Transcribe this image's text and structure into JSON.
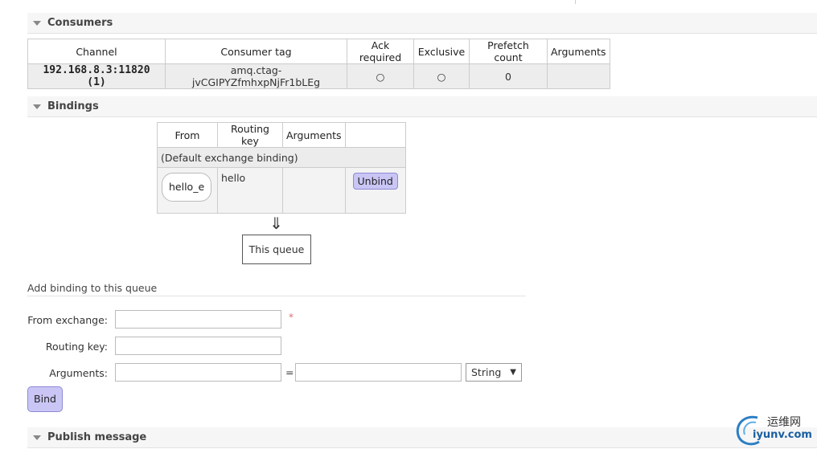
{
  "consumers": {
    "header": "Consumers",
    "columns": [
      "Channel",
      "Consumer tag",
      "Ack required",
      "Exclusive",
      "Prefetch count",
      "Arguments"
    ],
    "row": {
      "channel": "192.168.8.3:11820 (1)",
      "consumer_tag": "amq.ctag-jvCGIPYZfmhxpNjFr1bLEg",
      "ack_required": "○",
      "exclusive": "○",
      "prefetch_count": "0",
      "arguments": ""
    }
  },
  "bindings": {
    "header": "Bindings",
    "columns": [
      "From",
      "Routing key",
      "Arguments",
      ""
    ],
    "default_binding": "(Default exchange binding)",
    "row": {
      "from": "hello_e",
      "routing_key": "hello",
      "arguments": "",
      "unbind_label": "Unbind"
    },
    "arrow": "⇓",
    "this_queue": "This queue"
  },
  "add_binding": {
    "title": "Add binding to this queue",
    "from_exchange_label": "From exchange:",
    "from_exchange_value": "",
    "required_marker": "*",
    "routing_key_label": "Routing key:",
    "routing_key_value": "",
    "arguments_label": "Arguments:",
    "arguments_key_value": "",
    "equals": "=",
    "arguments_value": "",
    "type_selected": "String",
    "bind_label": "Bind"
  },
  "publish": {
    "header": "Publish message"
  },
  "watermark": {
    "cn": "运维网",
    "en": "iyunv.com"
  }
}
